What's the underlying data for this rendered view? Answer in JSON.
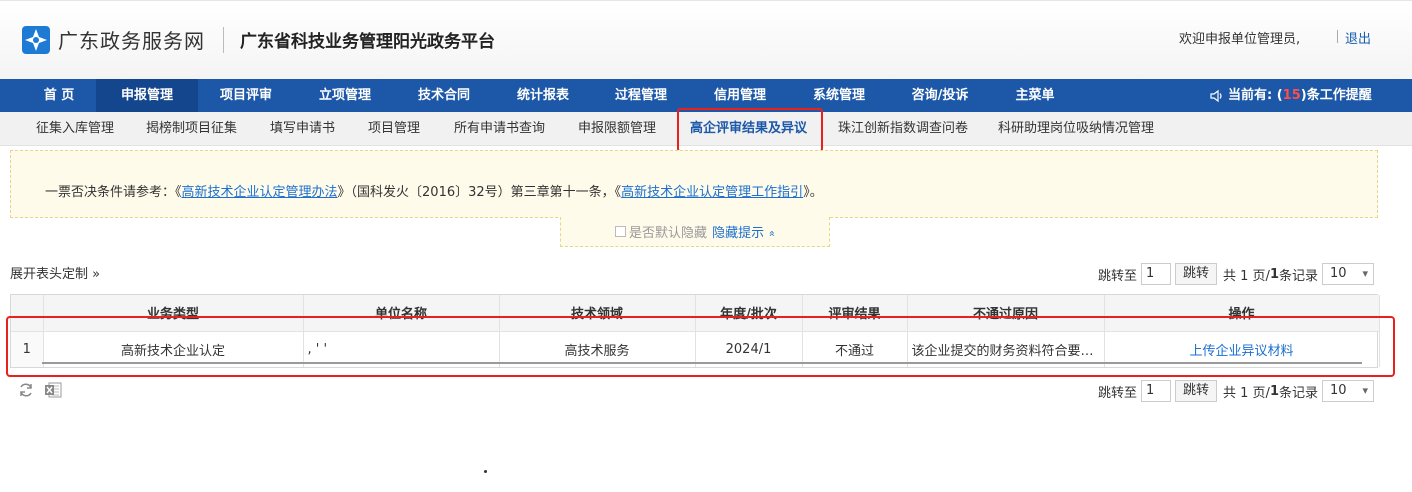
{
  "header": {
    "site_name": "广东政务服务网",
    "platform_title": "广东省科技业务管理阳光政务平台",
    "welcome": "欢迎申报单位管理员,",
    "logout": "退出"
  },
  "main_nav": {
    "items": [
      {
        "label": "首 页"
      },
      {
        "label": "申报管理"
      },
      {
        "label": "项目评审"
      },
      {
        "label": "立项管理"
      },
      {
        "label": "技术合同"
      },
      {
        "label": "统计报表"
      },
      {
        "label": "过程管理"
      },
      {
        "label": "信用管理"
      },
      {
        "label": "系统管理"
      },
      {
        "label": "咨询/投诉"
      },
      {
        "label": "主菜单"
      }
    ],
    "active_index": 1,
    "reminder": {
      "prefix": "当前有: (",
      "count": "15",
      "suffix": ")条工作提醒"
    }
  },
  "sub_nav": {
    "items": [
      {
        "label": "征集入库管理"
      },
      {
        "label": "揭榜制项目征集"
      },
      {
        "label": "填写申请书"
      },
      {
        "label": "项目管理"
      },
      {
        "label": "所有申请书查询"
      },
      {
        "label": "申报限额管理"
      },
      {
        "label": "高企评审结果及异议"
      },
      {
        "label": "珠江创新指数调查问卷"
      },
      {
        "label": "科研助理岗位吸纳情况管理"
      }
    ],
    "active_index": 6
  },
  "notice": {
    "prefix": "一票否决条件请参考：《",
    "link1": "高新技术企业认定管理办法",
    "middle": "》（国科发火〔2016〕32号）第三章第十一条，《",
    "link2": "高新技术企业认定管理工作指引",
    "suffix": "》。"
  },
  "hide_tip": {
    "checkbox_label": "是否默认隐藏",
    "link": "隐藏提示",
    "arrow": "»"
  },
  "expand_columns": "展开表头定制 »",
  "pager": {
    "jump_label": "跳转至",
    "page_value": "1",
    "jump_button": "跳转",
    "total_prefix": "共 1 页/",
    "total_count": "1",
    "total_suffix": " 条记录",
    "page_size": "10"
  },
  "table": {
    "columns": [
      "业务类型",
      "单位名称",
      "技术领域",
      "年度/批次",
      "评审结果",
      "不通过原因",
      "操作"
    ],
    "rows": [
      {
        "index": "1",
        "business_type": "高新技术企业认定",
        "company": ", ' '",
        "tech_field": "高技术服务",
        "year_batch": "2024/1",
        "result": "不通过",
        "reason": "该企业提交的财务资料符合要求...",
        "action": "上传企业异议材料"
      }
    ]
  },
  "colors": {
    "nav_bg": "#1c57a8",
    "nav_active": "#14468e",
    "link": "#1a6fd0",
    "highlight_box": "#e8211c",
    "notice_bg": "#fffbeb"
  },
  "icons": [
    "gd-logo-icon",
    "speaker-icon",
    "refresh-icon",
    "excel-export-icon"
  ]
}
